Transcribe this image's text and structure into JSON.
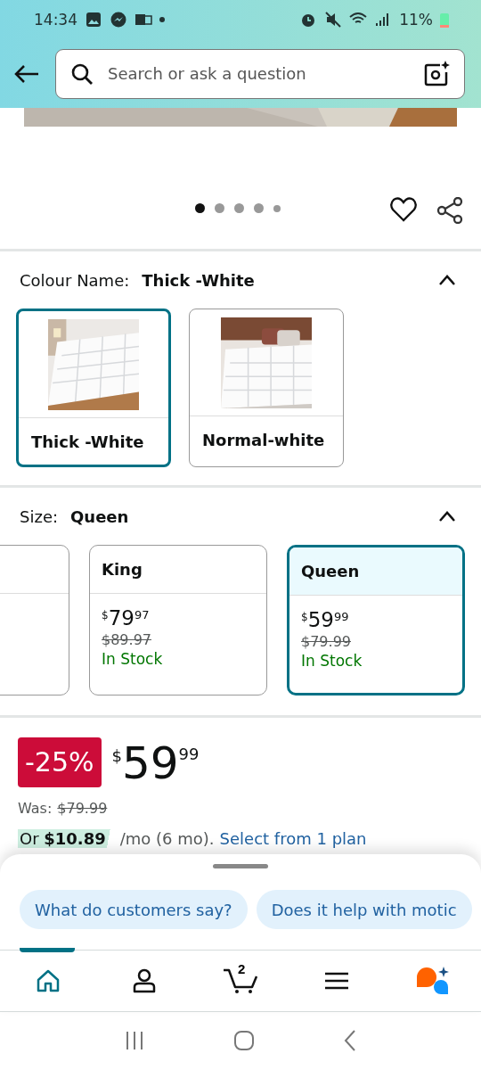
{
  "status_bar": {
    "time": "14:34",
    "battery": "11%"
  },
  "search": {
    "placeholder": "Search or ask a question"
  },
  "gallery": {
    "dots": [
      {
        "selected": true
      },
      {
        "selected": false
      },
      {
        "selected": false
      },
      {
        "selected": false
      },
      {
        "selected": false
      }
    ]
  },
  "colour": {
    "label": "Colour Name:",
    "value": "Thick -White",
    "expanded": true,
    "options": [
      {
        "label": "Thick -White",
        "selected": true
      },
      {
        "label": "Normal-white",
        "selected": false
      }
    ]
  },
  "size": {
    "label": "Size:",
    "value": "Queen",
    "expanded": true,
    "options": [
      {
        "kind": "partial",
        "selected": false
      },
      {
        "kind": "full",
        "label": "King",
        "currency": "$",
        "whole": "79",
        "fraction": "97",
        "list_price": "$89.97",
        "availability": "In Stock",
        "selected": false
      },
      {
        "kind": "full",
        "label": "Queen",
        "currency": "$",
        "whole": "59",
        "fraction": "99",
        "list_price": "$79.99",
        "availability": "In Stock",
        "selected": true
      }
    ]
  },
  "price": {
    "discount": "-25%",
    "currency": "$",
    "whole": "59",
    "fraction": "99",
    "was_label": "Was:",
    "was_price": "$79.99",
    "installment": "Or **$10.89**",
    "installment_terms": "/mo (6 mo).",
    "plan_link": "Select from 1 plan"
  },
  "questions": [
    "What do customers say?",
    "Does it help with motic"
  ],
  "nav": [
    {
      "kind": "home",
      "selected": true
    },
    {
      "kind": "account",
      "selected": false
    },
    {
      "kind": "cart",
      "badge": "2",
      "selected": false
    },
    {
      "kind": "menu",
      "selected": false
    },
    {
      "kind": "assistant",
      "selected": false
    }
  ]
}
